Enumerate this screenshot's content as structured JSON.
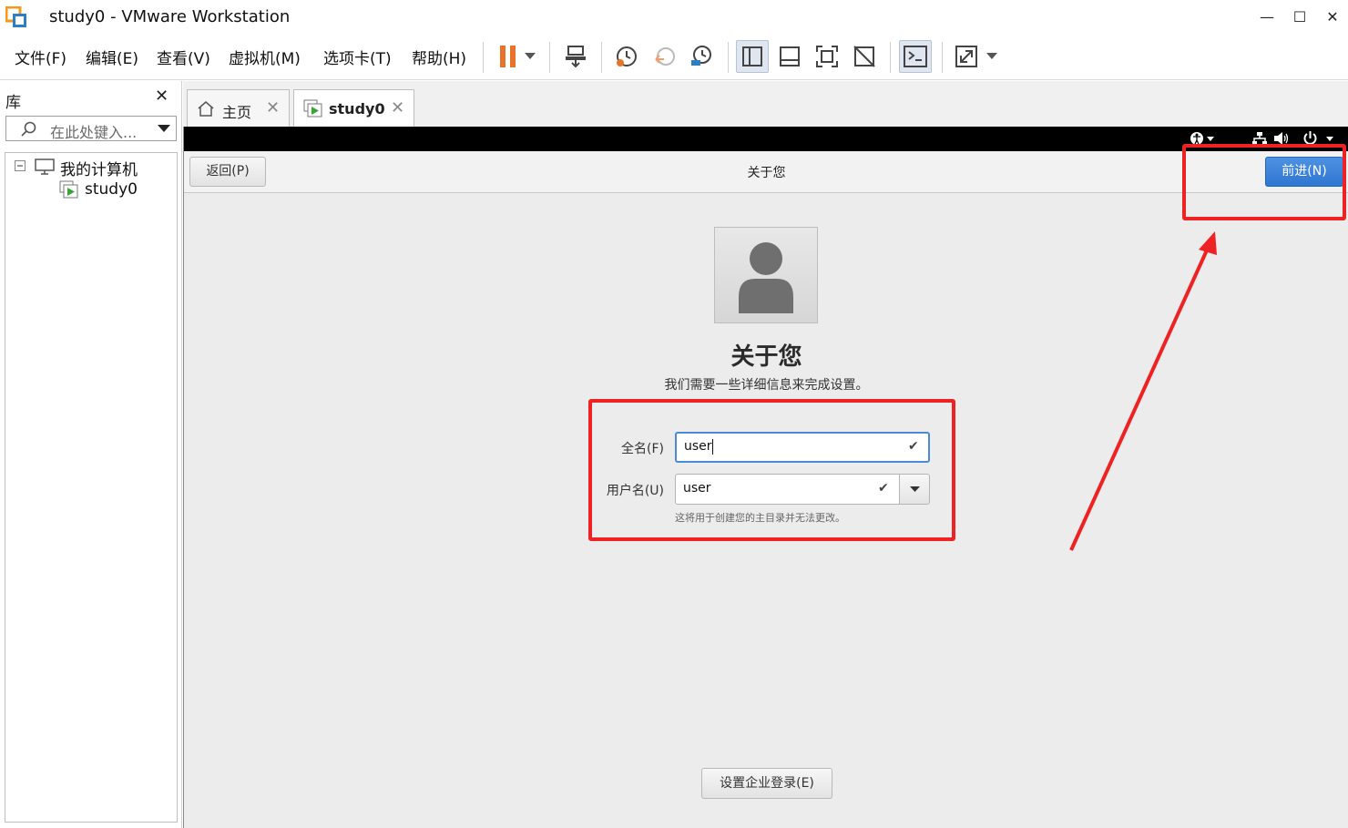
{
  "window": {
    "title": "study0 - VMware Workstation",
    "minimize": "—",
    "maximize": "☐",
    "close": "✕"
  },
  "menu": {
    "items": [
      "文件(F)",
      "编辑(E)",
      "查看(V)",
      "虚拟机(M)",
      "选项卡(T)",
      "帮助(H)"
    ]
  },
  "library": {
    "title": "库",
    "close": "✕",
    "search_placeholder": "在此处键入...",
    "tree": {
      "root": "我的计算机",
      "child": "study0"
    }
  },
  "tabs": [
    {
      "label": "主页",
      "icon": "home-icon"
    },
    {
      "label": "study0",
      "icon": "vm-icon"
    }
  ],
  "vm": {
    "header": {
      "back": "返回(P)",
      "title": "关于您",
      "next": "前进(N)"
    },
    "page": {
      "heading": "关于您",
      "subtitle": "我们需要一些详细信息来完成设置。",
      "fullname_label": "全名(F)",
      "fullname_value": "user",
      "username_label": "用户名(U)",
      "username_value": "user",
      "hint": "这将用于创建您的主目录并无法更改。",
      "enterprise_button": "设置企业登录(E)"
    }
  },
  "colors": {
    "accent": "#2f76d2",
    "highlight": "#ee2222",
    "pause": "#e8742a"
  }
}
